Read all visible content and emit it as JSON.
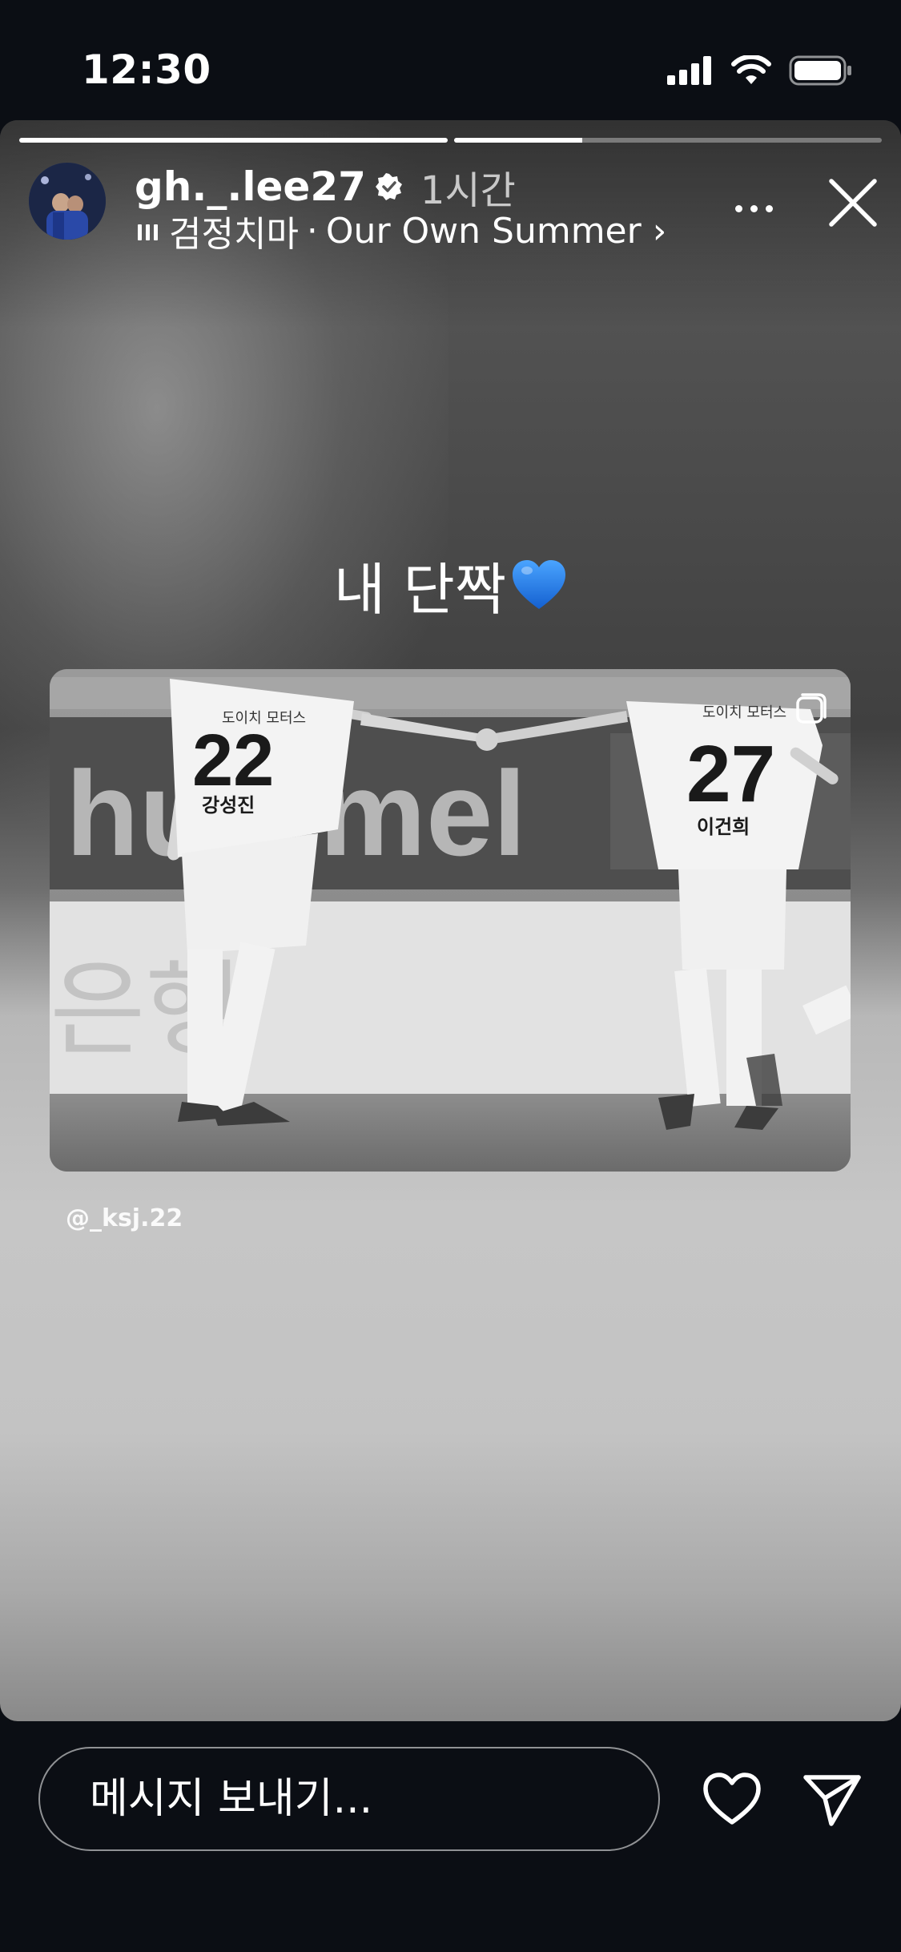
{
  "status_bar": {
    "time": "12:30"
  },
  "story": {
    "progress": [
      1.0,
      0.3
    ],
    "username": "gh._.lee27",
    "time_ago": "1시간",
    "music": {
      "title": "검정치마",
      "separator": "·",
      "artist": "Our Own Summer ›"
    },
    "caption": "내 단짝",
    "caption_emoji": "blue-heart",
    "mention": "@_ksj.22",
    "photo": {
      "jersey_left_number": "22",
      "jersey_left_name": "강성진",
      "jersey_right_number": "27",
      "jersey_right_name": "이건희",
      "sponsor": "도이치 모터스",
      "board_text_top": "hummel",
      "board_text_bottom": "은행"
    }
  },
  "reply": {
    "placeholder": "메시지 보내기..."
  },
  "colors": {
    "background": "#0b0e14",
    "heart_blue": "#1f7ae0"
  }
}
